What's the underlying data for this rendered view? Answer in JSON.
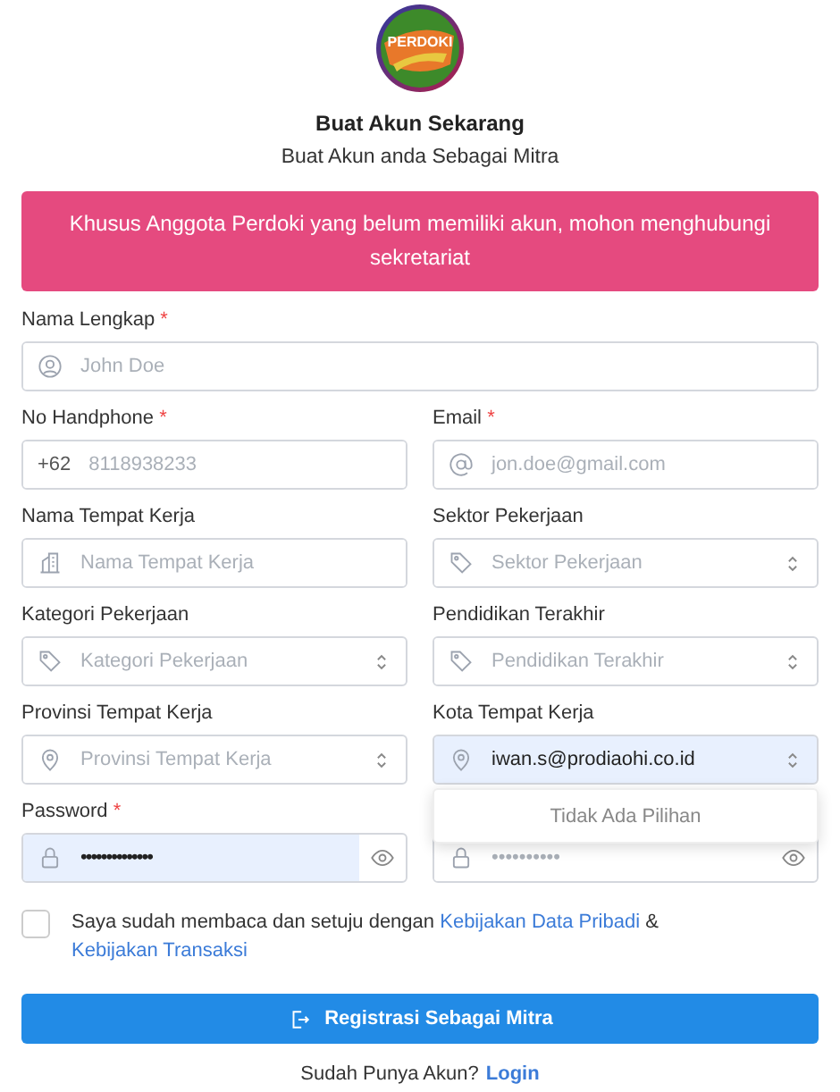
{
  "logo": {
    "text": "PERDOKI"
  },
  "title": "Buat Akun Sekarang",
  "subtitle": "Buat Akun anda Sebagai Mitra",
  "alert": "Khusus Anggota Perdoki yang belum memiliki akun, mohon menghubungi sekretariat",
  "rows": [
    [
      {
        "label": "Nama Lengkap",
        "required": "*",
        "kind": "person",
        "placeholder": "John Doe"
      }
    ],
    [
      {
        "label": "No Handphone",
        "required": "*",
        "kind": "phone",
        "prefix": "+62",
        "placeholder": "8118938233"
      },
      {
        "label": "Email",
        "required": "*",
        "kind": "email",
        "placeholder": "jon.doe@gmail.com"
      }
    ],
    [
      {
        "label": "Nama Tempat Kerja",
        "kind": "building",
        "placeholder": "Nama Tempat Kerja"
      },
      {
        "label": "Sektor Pekerjaan",
        "kind": "tag",
        "placeholder": "Sektor Pekerjaan"
      }
    ],
    [
      {
        "label": "Kategori Pekerjaan",
        "kind": "tag",
        "placeholder": "Kategori Pekerjaan"
      },
      {
        "label": "Pendidikan Terakhir",
        "kind": "tag",
        "placeholder": "Pendidikan Terakhir"
      }
    ],
    [
      {
        "label": "Provinsi Tempat Kerja",
        "kind": "location",
        "placeholder": "Provinsi Tempat Kerja"
      },
      {
        "label": "Kota Tempat Kerja",
        "kind": "location",
        "value": "iwan.s@prodiaohi.co.id",
        "autofill": true,
        "dropdown": "Tidak Ada Pilihan"
      }
    ],
    [
      {
        "label": "Password",
        "required": "*",
        "kind": "password",
        "value": "••••••••••••••",
        "autofill": true
      },
      {
        "kind": "password",
        "placeholder": "••••••••••"
      }
    ]
  ],
  "agreement": {
    "checked": false,
    "text": "Saya sudah membaca dan setuju dengan",
    "link_1": "Kebijakan Data Pribadi",
    "joiner": "&",
    "link_2": "Kebijakan Transaksi"
  },
  "submit": "Registrasi Sebagai Mitra",
  "footer": {
    "text": "Sudah Punya Akun?",
    "link": "Login"
  }
}
